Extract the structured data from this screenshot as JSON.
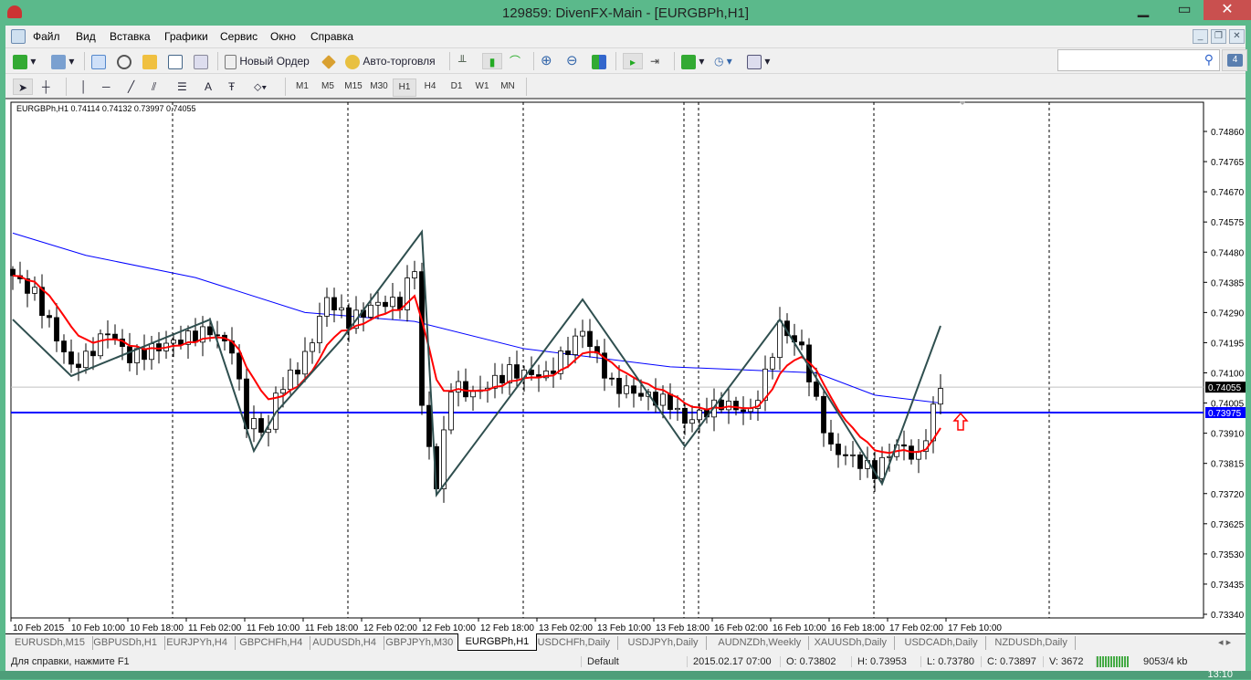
{
  "window": {
    "title": "129859: DivenFX-Main - [EURGBPh,H1]",
    "minimize": "▁",
    "maximize": "▭",
    "close": "✕"
  },
  "menu": [
    "Файл",
    "Вид",
    "Вставка",
    "Графики",
    "Сервис",
    "Окно",
    "Справка"
  ],
  "toolbar": {
    "new_order": "Новый Ордер",
    "auto_trading": "Авто-торговля",
    "search_placeholder": "",
    "notifications": "4"
  },
  "timeframes": [
    "M1",
    "M5",
    "M15",
    "M30",
    "H1",
    "H4",
    "D1",
    "W1",
    "MN"
  ],
  "active_timeframe": "H1",
  "chart_data": {
    "type": "candlestick",
    "symbol_info": "EURGBPh,H1  0.74114 0.74132 0.73997 0.74055",
    "ylim": [
      0.7334,
      0.7486
    ],
    "y_ticks": [
      "0.74860",
      "0.74765",
      "0.74670",
      "0.74575",
      "0.74480",
      "0.74385",
      "0.74290",
      "0.74195",
      "0.74100",
      "0.74005",
      "0.73910",
      "0.73815",
      "0.73720",
      "0.73625",
      "0.73530",
      "0.73435",
      "0.73340"
    ],
    "x_ticks": [
      "10 Feb 2015",
      "10 Feb 10:00",
      "10 Feb 18:00",
      "11 Feb 02:00",
      "11 Feb 10:00",
      "11 Feb 18:00",
      "12 Feb 02:00",
      "12 Feb 10:00",
      "12 Feb 18:00",
      "13 Feb 02:00",
      "13 Feb 10:00",
      "13 Feb 18:00",
      "16 Feb 02:00",
      "16 Feb 10:00",
      "16 Feb 18:00",
      "17 Feb 02:00",
      "17 Feb 10:00"
    ],
    "candle_count": 128,
    "close_keypoints": [
      [
        0,
        0.74406
      ],
      [
        3,
        0.74348
      ],
      [
        8,
        0.74119
      ],
      [
        10,
        0.74147
      ],
      [
        13,
        0.74233
      ],
      [
        16,
        0.74147
      ],
      [
        21,
        0.7419
      ],
      [
        27,
        0.74233
      ],
      [
        30,
        0.74176
      ],
      [
        32,
        0.73946
      ],
      [
        35,
        0.73917
      ],
      [
        36,
        0.74032
      ],
      [
        40,
        0.74147
      ],
      [
        43,
        0.74334
      ],
      [
        46,
        0.74262
      ],
      [
        50,
        0.7432
      ],
      [
        53,
        0.7432
      ],
      [
        55,
        0.74435
      ],
      [
        56,
        0.73989
      ],
      [
        58,
        0.73745
      ],
      [
        60,
        0.74061
      ],
      [
        63,
        0.74032
      ],
      [
        68,
        0.74104
      ],
      [
        73,
        0.7409
      ],
      [
        78,
        0.74233
      ],
      [
        82,
        0.74061
      ],
      [
        86,
        0.74032
      ],
      [
        90,
        0.74004
      ],
      [
        92,
        0.73946
      ],
      [
        97,
        0.74004
      ],
      [
        101,
        0.73975
      ],
      [
        103,
        0.7409
      ],
      [
        105,
        0.74248
      ],
      [
        108,
        0.74176
      ],
      [
        110,
        0.74004
      ],
      [
        112,
        0.7386
      ],
      [
        115,
        0.73831
      ],
      [
        118,
        0.73788
      ],
      [
        121,
        0.73874
      ],
      [
        124,
        0.73831
      ],
      [
        127,
        0.74061
      ],
      [
        128,
        0.7409
      ]
    ],
    "zigzag": [
      [
        0,
        0.74268
      ],
      [
        8,
        0.7409
      ],
      [
        27,
        0.74268
      ],
      [
        33,
        0.73854
      ],
      [
        36,
        0.73975
      ],
      [
        45,
        0.74205
      ],
      [
        56,
        0.74544
      ],
      [
        58,
        0.73716
      ],
      [
        78,
        0.74331
      ],
      [
        92,
        0.73869
      ],
      [
        105,
        0.74268
      ],
      [
        119,
        0.73751
      ],
      [
        127,
        0.74248
      ]
    ],
    "ma_slow": [
      [
        0,
        0.7454
      ],
      [
        10,
        0.7447
      ],
      [
        25,
        0.744
      ],
      [
        40,
        0.7429
      ],
      [
        55,
        0.74262
      ],
      [
        70,
        0.74176
      ],
      [
        90,
        0.74119
      ],
      [
        110,
        0.741
      ],
      [
        118,
        0.7403
      ],
      [
        127,
        0.74005
      ]
    ],
    "bid_line": {
      "label": "0.74055",
      "value": 0.74055
    },
    "hline": {
      "label": "0.73975",
      "value": 0.73975
    },
    "colors": {
      "ma_fast": "#ff0000",
      "ma_slow": "#0000ff",
      "zigzag": "#2f4f4f",
      "hline": "#0000ff",
      "arrow": "#ff0000"
    }
  },
  "tabs": [
    "EURUSDh,M15",
    "GBPUSDh,H1",
    "EURJPYh,H4",
    "GBPCHFh,H4",
    "AUDUSDh,H4",
    "GBPJPYh,M30",
    "EURGBPh,H1",
    "USDCHFh,Daily",
    "USDJPYh,Daily",
    "AUDNZDh,Weekly",
    "XAUUSDh,Daily",
    "USDCADh,Daily",
    "NZDUSDh,Daily"
  ],
  "status": {
    "help": "Для справки, нажмите F1",
    "profile": "Default",
    "datetime": "2015.02.17 07:00",
    "open": "O: 0.73802",
    "high": "H: 0.73953",
    "low": "L: 0.73780",
    "close": "C: 0.73897",
    "volume": "V: 3672",
    "traffic": "9053/4 kb"
  },
  "clock": "13:10"
}
